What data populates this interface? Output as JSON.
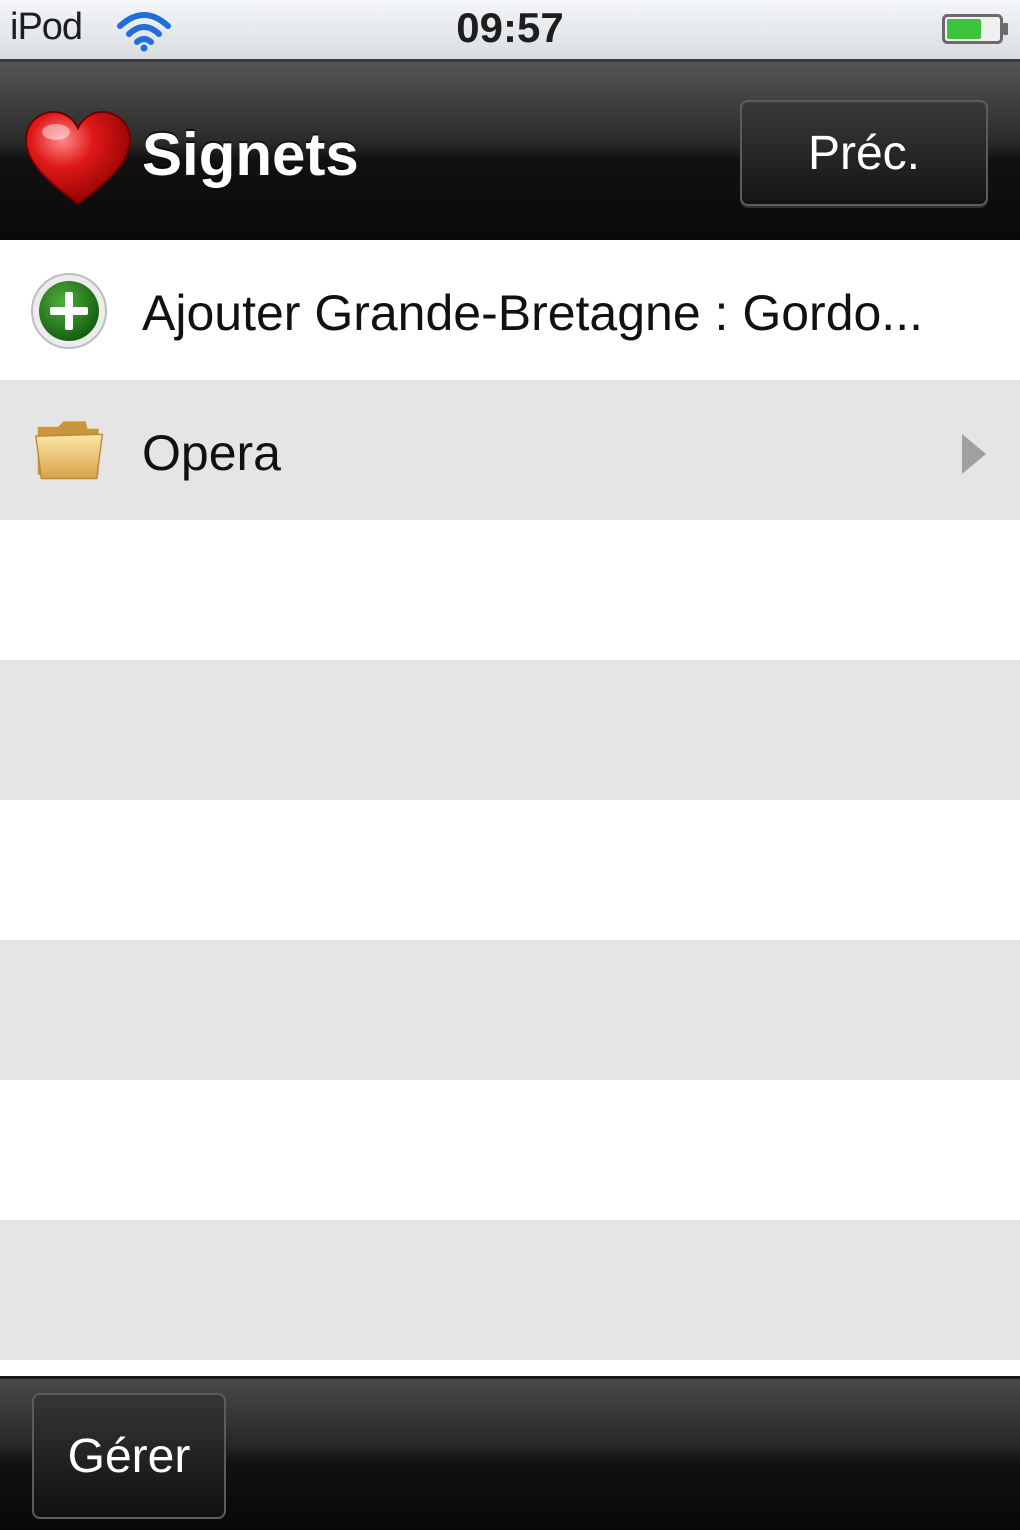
{
  "status_bar": {
    "carrier": "iPod",
    "time": "09:57",
    "wifi_icon": "wifi-icon",
    "battery_icon": "battery-icon",
    "battery_color": "#3cc43c"
  },
  "nav_bar": {
    "icon": "heart-icon",
    "title": "Signets",
    "back_label": "Préc."
  },
  "list": {
    "items": [
      {
        "label": "Ajouter Grande-Bretagne : Gordo...",
        "icon": "add-icon"
      },
      {
        "label": "Opera",
        "icon": "folder-icon",
        "disclosure": "chevron-right-icon"
      }
    ]
  },
  "toolbar": {
    "manage_label": "Gérer"
  }
}
